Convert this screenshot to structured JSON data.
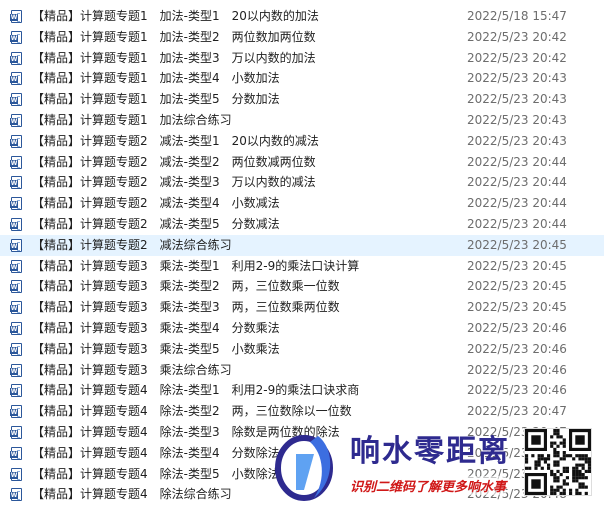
{
  "files": [
    {
      "name": "【精品】计算题专题1　加法-类型1　20以内数的加法",
      "date": "2022/5/18 15:47"
    },
    {
      "name": "【精品】计算题专题1　加法-类型2　两位数加两位数",
      "date": "2022/5/23 20:42"
    },
    {
      "name": "【精品】计算题专题1　加法-类型3　万以内数的加法",
      "date": "2022/5/23 20:42"
    },
    {
      "name": "【精品】计算题专题1　加法-类型4　小数加法",
      "date": "2022/5/23 20:43"
    },
    {
      "name": "【精品】计算题专题1　加法-类型5　分数加法",
      "date": "2022/5/23 20:43"
    },
    {
      "name": "【精品】计算题专题1　加法综合练习",
      "date": "2022/5/23 20:43"
    },
    {
      "name": "【精品】计算题专题2　减法-类型1　20以内数的减法",
      "date": "2022/5/23 20:43"
    },
    {
      "name": "【精品】计算题专题2　减法-类型2　两位数减两位数",
      "date": "2022/5/23 20:44"
    },
    {
      "name": "【精品】计算题专题2　减法-类型3　万以内数的减法",
      "date": "2022/5/23 20:44"
    },
    {
      "name": "【精品】计算题专题2　减法-类型4　小数减法",
      "date": "2022/5/23 20:44"
    },
    {
      "name": "【精品】计算题专题2　减法-类型5　分数减法",
      "date": "2022/5/23 20:44"
    },
    {
      "name": "【精品】计算题专题2　减法综合练习",
      "date": "2022/5/23 20:45"
    },
    {
      "name": "【精品】计算题专题3　乘法-类型1　利用2-9的乘法口诀计算",
      "date": "2022/5/23 20:45"
    },
    {
      "name": "【精品】计算题专题3　乘法-类型2　两，三位数乘一位数",
      "date": "2022/5/23 20:45"
    },
    {
      "name": "【精品】计算题专题3　乘法-类型3　两，三位数乘两位数",
      "date": "2022/5/23 20:45"
    },
    {
      "name": "【精品】计算题专题3　乘法-类型4　分数乘法",
      "date": "2022/5/23 20:46"
    },
    {
      "name": "【精品】计算题专题3　乘法-类型5　小数乘法",
      "date": "2022/5/23 20:46"
    },
    {
      "name": "【精品】计算题专题3　乘法综合练习",
      "date": "2022/5/23 20:46"
    },
    {
      "name": "【精品】计算题专题4　除法-类型1　利用2-9的乘法口诀求商",
      "date": "2022/5/23 20:46"
    },
    {
      "name": "【精品】计算题专题4　除法-类型2　两，三位数除以一位数",
      "date": "2022/5/23 20:47"
    },
    {
      "name": "【精品】计算题专题4　除法-类型3　除数是两位数的除法",
      "date": "2022/5/23 20:47"
    },
    {
      "name": "【精品】计算题专题4　除法-类型4　分数除法",
      "date": "2022/5/23 20:47"
    },
    {
      "name": "【精品】计算题专题4　除法-类型5　小数除法",
      "date": "2022/5/23 20:48"
    },
    {
      "name": "【精品】计算题专题4　除法综合练习",
      "date": "2022/5/23 20:48"
    }
  ],
  "selected_index": 11,
  "colors": {
    "selection": "#e5f3ff",
    "date_text": "#6d6d6d",
    "word_icon": "#2b579a"
  },
  "icon": "word-document-icon",
  "watermark": {
    "title": "响水零距离",
    "subtitle": "识别二维码了解更多响水事"
  }
}
